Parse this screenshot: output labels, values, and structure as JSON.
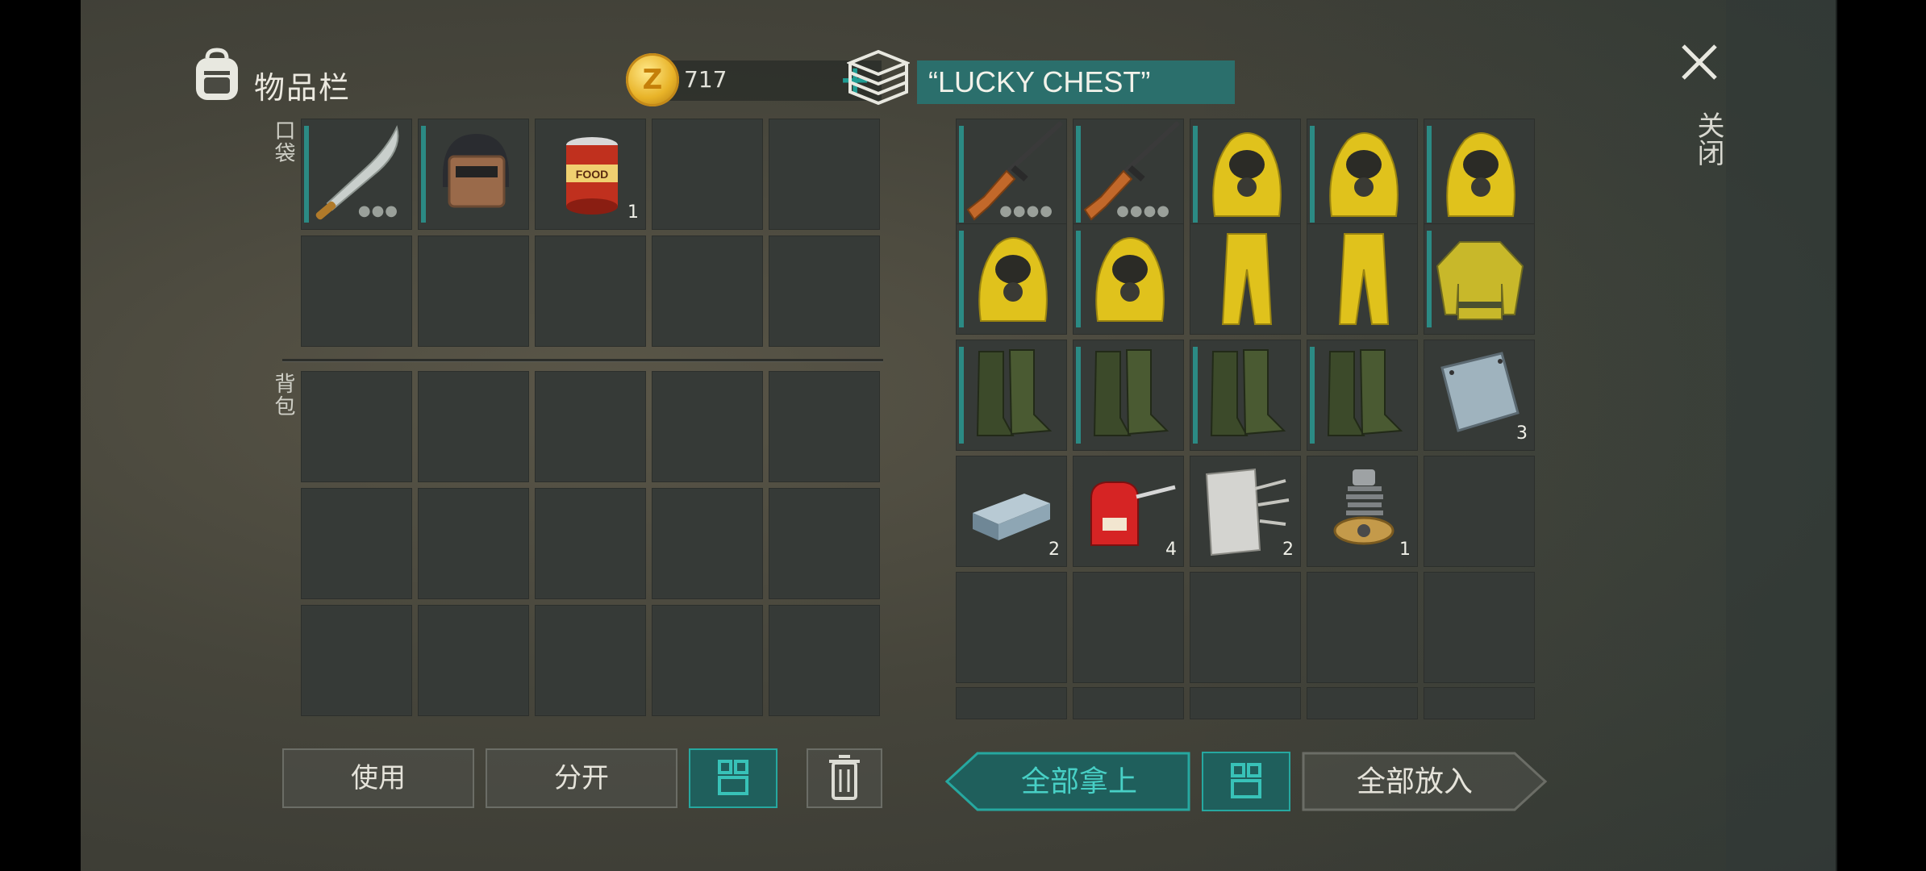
{
  "inventory": {
    "title": "物品栏",
    "coins": "717",
    "plus_label": "+",
    "pockets_label": "口袋",
    "backpack_label": "背包",
    "pocket_slots": [
      {
        "item": "machete-icon",
        "count": "",
        "dots": "●●●"
      },
      {
        "item": "riot-helmet-icon",
        "count": "",
        "dots": ""
      },
      {
        "item": "canned-food-icon",
        "count": "1",
        "dots": ""
      },
      {
        "item": "",
        "count": "",
        "dots": ""
      },
      {
        "item": "",
        "count": "",
        "dots": ""
      }
    ],
    "buttons": {
      "use": "使用",
      "split": "分开",
      "sort": "grid-sort-icon",
      "delete": "trash-icon"
    }
  },
  "chest": {
    "name": "“LUCKY CHEST”",
    "take_all": "全部拿上",
    "put_all": "全部放入",
    "sort": "grid-sort-icon",
    "slots": [
      {
        "item": "rifle-icon",
        "count": "",
        "dots": "●●●●"
      },
      {
        "item": "rifle-icon",
        "count": "",
        "dots": "●●●●"
      },
      {
        "item": "hazmat-hood-icon",
        "count": "",
        "dots": ""
      },
      {
        "item": "hazmat-hood-icon",
        "count": "",
        "dots": ""
      },
      {
        "item": "hazmat-hood-icon",
        "count": "",
        "dots": ""
      },
      {
        "item": "hazmat-hood-icon",
        "count": "",
        "dots": ""
      },
      {
        "item": "hazmat-hood-icon",
        "count": "",
        "dots": ""
      },
      {
        "item": "hazmat-pants-icon",
        "count": "",
        "dots": ""
      },
      {
        "item": "hazmat-pants-icon",
        "count": "",
        "dots": ""
      },
      {
        "item": "hazmat-jacket-icon",
        "count": "",
        "dots": ""
      },
      {
        "item": "rubber-boots-icon",
        "count": "",
        "dots": ""
      },
      {
        "item": "rubber-boots-icon",
        "count": "",
        "dots": ""
      },
      {
        "item": "rubber-boots-icon",
        "count": "",
        "dots": ""
      },
      {
        "item": "rubber-boots-icon",
        "count": "",
        "dots": ""
      },
      {
        "item": "metal-plate-icon",
        "count": "3",
        "dots": ""
      },
      {
        "item": "steel-ingot-icon",
        "count": "2",
        "dots": ""
      },
      {
        "item": "oil-can-icon",
        "count": "4",
        "dots": ""
      },
      {
        "item": "fabric-roll-icon",
        "count": "2",
        "dots": ""
      },
      {
        "item": "spring-mechanism-icon",
        "count": "1",
        "dots": ""
      },
      {
        "item": "",
        "count": "",
        "dots": ""
      }
    ]
  },
  "close_label": "关闭",
  "colors": {
    "accent": "#26a8a0",
    "chest_title_bg": "#2b6f6c",
    "coin": "#e8b328"
  }
}
